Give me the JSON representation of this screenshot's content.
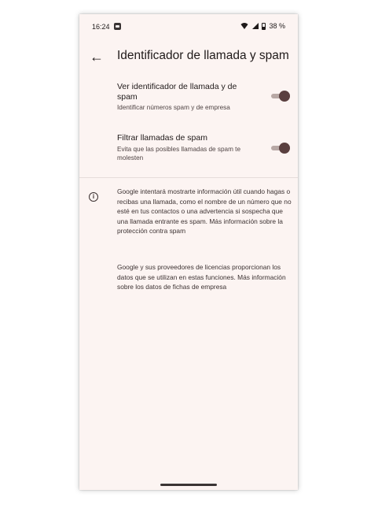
{
  "status": {
    "time": "16:24",
    "battery": "38 %"
  },
  "header": {
    "title": "Identificador de llamada y spam"
  },
  "settings": [
    {
      "label": "Ver identificador de llamada y de spam",
      "desc": "Identificar números spam y de empresa",
      "enabled": true
    },
    {
      "label": "Filtrar llamadas de spam",
      "desc": "Evita que las posibles llamadas de spam te molesten",
      "enabled": true
    }
  ],
  "info": {
    "p1": "Google intentará mostrarte información útil cuando hagas o recibas una llamada, como el nombre de un número que no esté en tus contactos o una advertencia si sospecha que una llamada entrante es spam. Más información sobre la protección contra spam",
    "p2": "Google y sus proveedores de licencias proporcionan los datos que se utilizan en estas funciones. Más información sobre los datos de fichas de empresa"
  },
  "icons": {
    "back": "arrow-back-icon",
    "info": "info-icon"
  },
  "colors": {
    "background": "#fcf4f2",
    "toggle_thumb": "#5a3f3f",
    "toggle_track": "#b8a8a5"
  }
}
